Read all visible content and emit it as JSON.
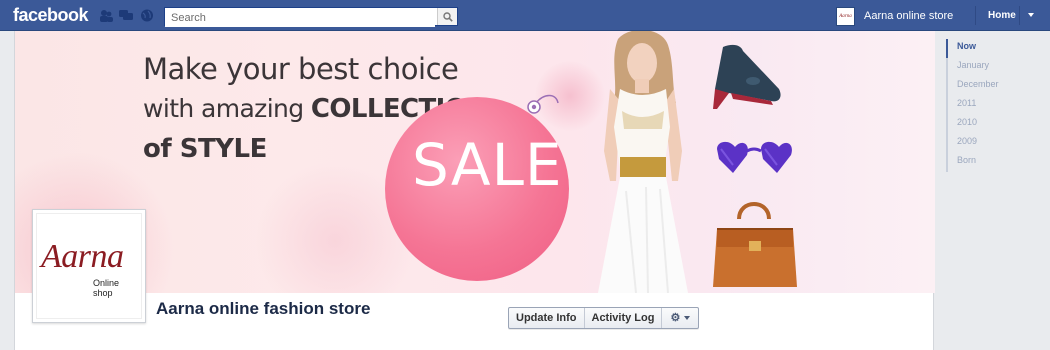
{
  "topbar": {
    "logo": "facebook",
    "search_placeholder": "Search",
    "page_name": "Aarna online store",
    "home_label": "Home"
  },
  "cover": {
    "headline_line1": "Make your best choice",
    "headline_line2_a": "with amazing",
    "headline_line2_b": "COLLECTION",
    "headline_line3": "of STYLE",
    "sale_text": "SALE"
  },
  "profile": {
    "logo_text": "Aarna",
    "logo_sub": "Online shop",
    "page_title": "Aarna online fashion store"
  },
  "actions": {
    "update_info": "Update Info",
    "activity_log": "Activity Log"
  },
  "timeline": [
    "Now",
    "January",
    "December",
    "2011",
    "2010",
    "2009",
    "Born"
  ],
  "colors": {
    "brand_blue": "#3b5998",
    "sale_pink": "#f57595",
    "logo_red": "#8b1c22"
  }
}
